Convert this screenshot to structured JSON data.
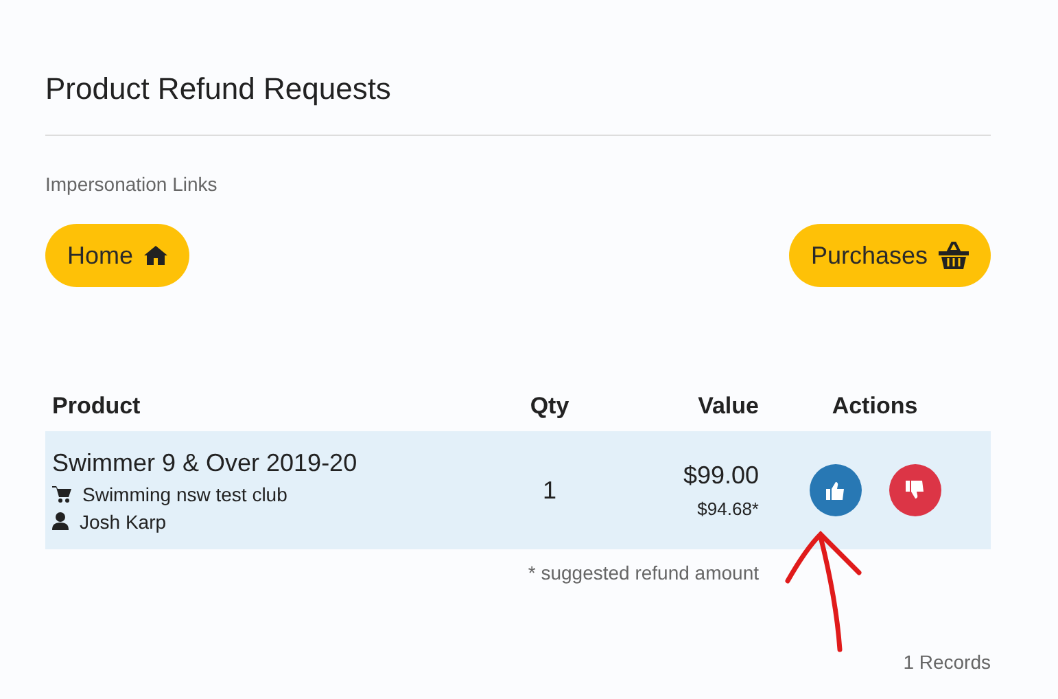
{
  "title": "Product Refund Requests",
  "subtitle": "Impersonation Links",
  "buttons": [
    {
      "label": "Home",
      "kind": "home"
    },
    {
      "label": "Purchases",
      "kind": "basket"
    }
  ],
  "table": {
    "columns": [
      "Product",
      "Qty",
      "Value",
      "Actions"
    ],
    "rows": [
      {
        "product": "Swimmer 9 & Over 2019-20",
        "club": "Swimming nsw test club",
        "person": "Josh Karp",
        "qty": "1",
        "value": "$99.00",
        "suggested": "$94.68*",
        "actions": [
          {
            "kind": "approve"
          },
          {
            "kind": "reject"
          }
        ]
      }
    ]
  },
  "footnote": "* suggested refund amount",
  "annotation": {
    "kind": "arrow"
  },
  "records": "1 Records"
}
